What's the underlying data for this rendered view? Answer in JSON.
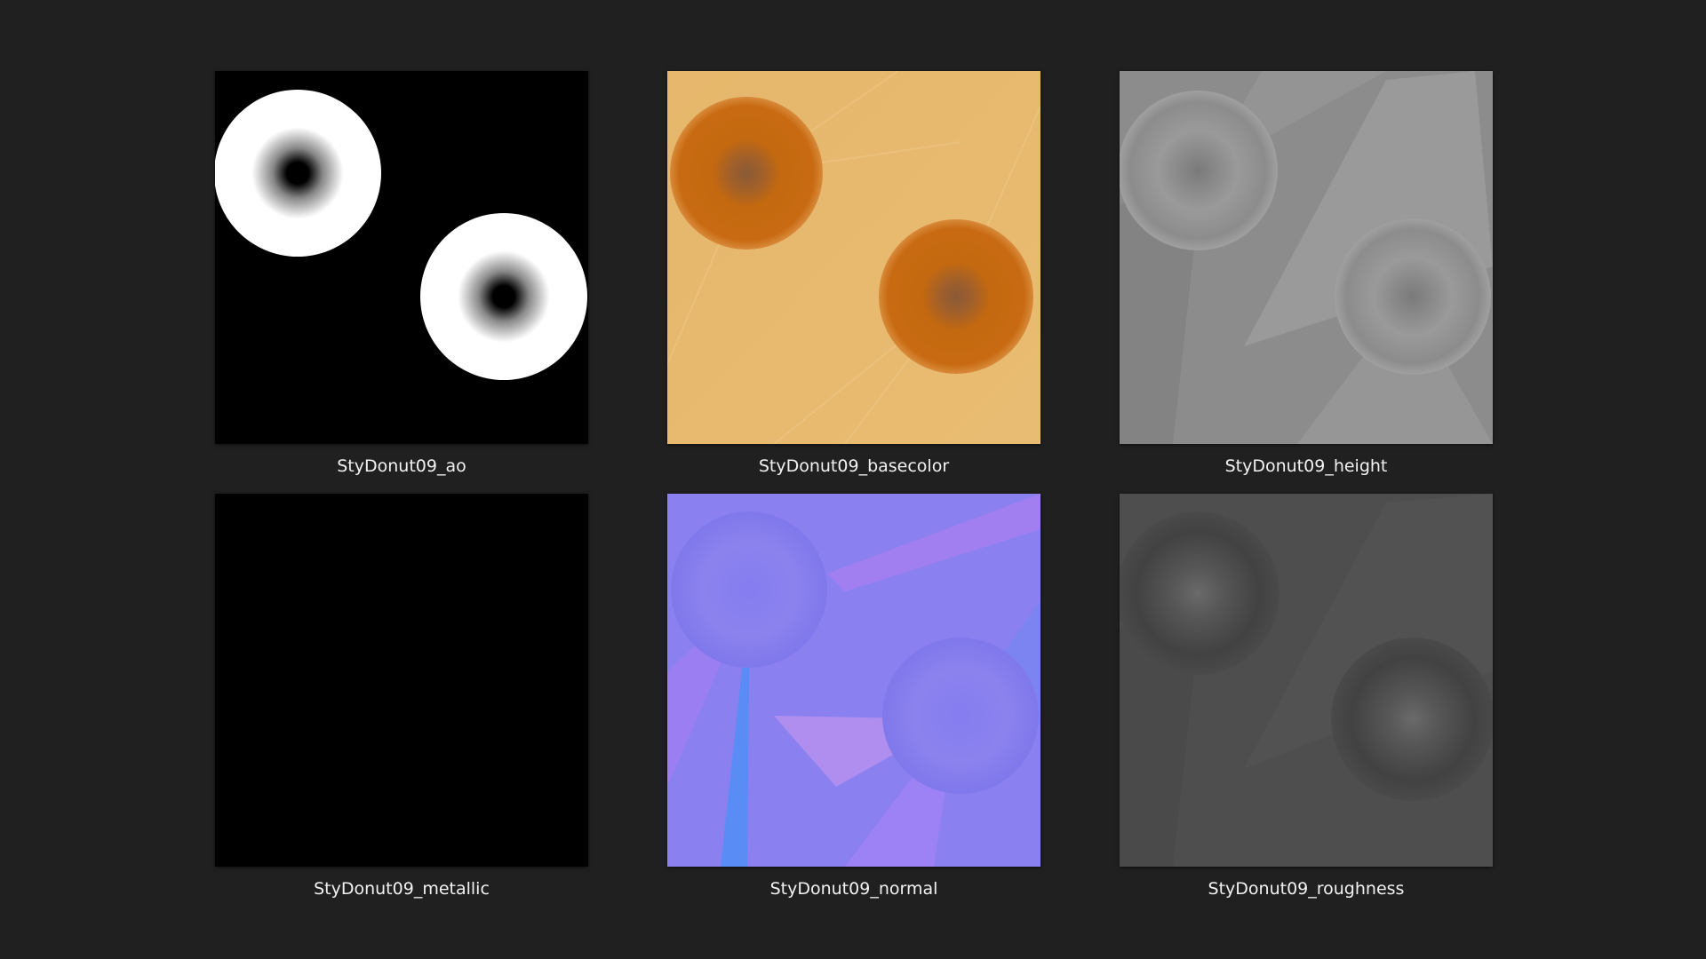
{
  "colors": {
    "background": "#202020",
    "caption_text": "#f2f2f2",
    "ao_background": "#000000",
    "ao_donut": "#ffffff",
    "basecolor_background": "#e3b468",
    "basecolor_donut": "#c86a12",
    "height_background": "#8a8a8a",
    "metallic_background": "#000000",
    "normal_background": "#8a7ff0",
    "roughness_background": "#4e4e4e"
  },
  "files": [
    {
      "name": "StyDonut09_ao",
      "thumbnail": "ao-texture"
    },
    {
      "name": "StyDonut09_basecolor",
      "thumbnail": "basecolor-texture"
    },
    {
      "name": "StyDonut09_height",
      "thumbnail": "height-texture"
    },
    {
      "name": "StyDonut09_metallic",
      "thumbnail": "metallic-texture"
    },
    {
      "name": "StyDonut09_normal",
      "thumbnail": "normal-texture"
    },
    {
      "name": "StyDonut09_roughness",
      "thumbnail": "roughness-texture"
    }
  ]
}
